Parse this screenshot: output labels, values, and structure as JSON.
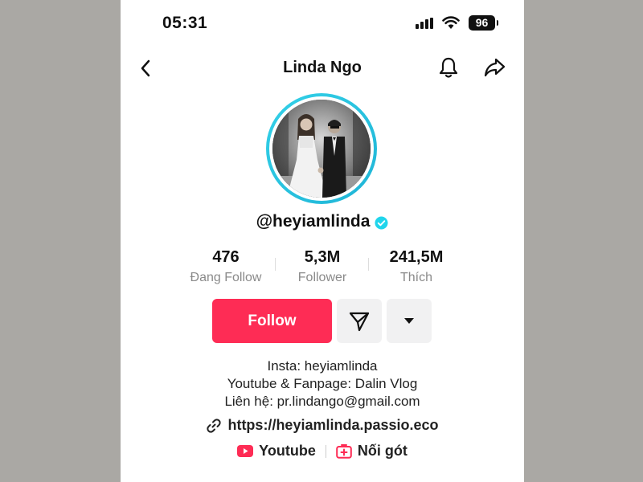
{
  "status_bar": {
    "time": "05:31",
    "battery": "96"
  },
  "header": {
    "title": "Linda Ngo"
  },
  "profile": {
    "username": "@heyiamlinda"
  },
  "stats": [
    {
      "value": "476",
      "label": "Đang Follow"
    },
    {
      "value": "5,3M",
      "label": "Follower"
    },
    {
      "value": "241,5M",
      "label": "Thích"
    }
  ],
  "actions": {
    "follow_label": "Follow"
  },
  "bio": {
    "lines": [
      "Insta: heyiamlinda",
      "Youtube & Fanpage: Dalin Vlog",
      "Liên hệ: pr.lindango@gmail.com"
    ],
    "link": "https://heyiamlinda.passio.eco"
  },
  "social": [
    {
      "label": "Youtube",
      "icon": "youtube-icon"
    },
    {
      "label": "Nối gót",
      "icon": "add-video-icon"
    }
  ],
  "colors": {
    "accent": "#fe2c55",
    "verified": "#20d5ec",
    "avatar_ring": "#33d1e8"
  }
}
